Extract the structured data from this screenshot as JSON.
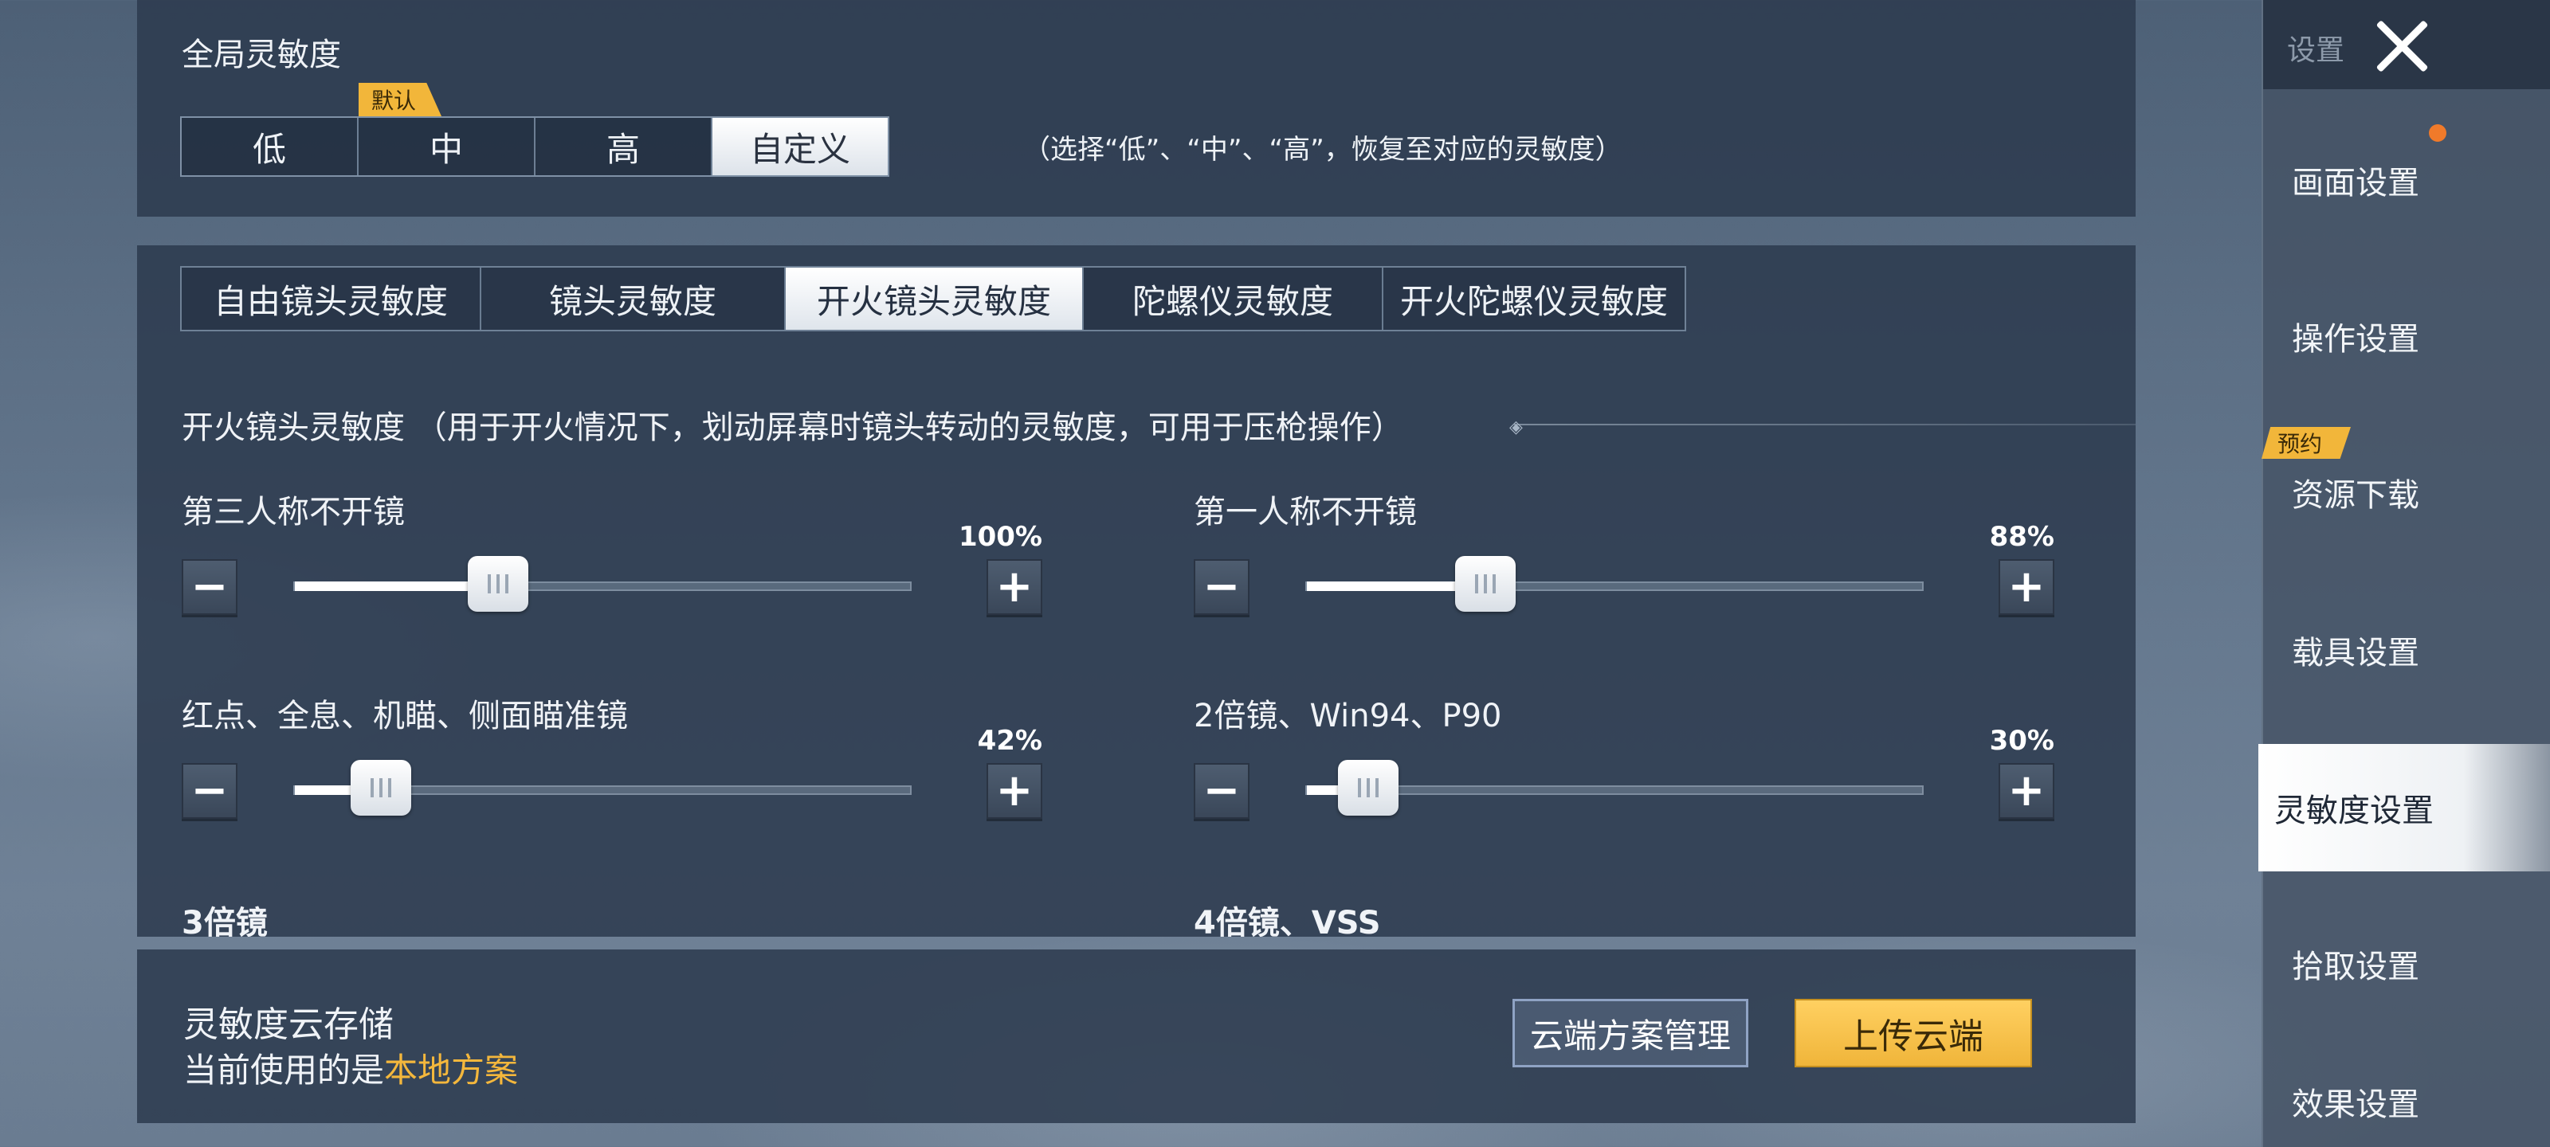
{
  "global": {
    "title": "全局灵敏度",
    "presets": [
      "低",
      "中",
      "高",
      "自定义"
    ],
    "active_preset_index": 3,
    "default_badge": "默认",
    "hint": "（选择“低”、“中”、“高”，恢复至对应的灵敏度）"
  },
  "tabs": [
    {
      "label": "自由镜头灵敏度",
      "active": false
    },
    {
      "label": "镜头灵敏度",
      "active": false
    },
    {
      "label": "开火镜头灵敏度",
      "active": true
    },
    {
      "label": "陀螺仪灵敏度",
      "active": false
    },
    {
      "label": "开火陀螺仪灵敏度",
      "active": false
    }
  ],
  "section": {
    "title": "开火镜头灵敏度 （用于开火情况下，划动屏幕时镜头转动的灵敏度，可用于压枪操作）"
  },
  "sliders": [
    {
      "label": "第三人称不开镜",
      "percent_text": "100%",
      "level": 0.33
    },
    {
      "label": "第一人称不开镜",
      "percent_text": "88%",
      "level": 0.29
    },
    {
      "label": "红点、全息、机瞄、侧面瞄准镜",
      "percent_text": "42%",
      "level": 0.14
    },
    {
      "label": "2倍镜、Win94、P90",
      "percent_text": "30%",
      "level": 0.1
    }
  ],
  "cut_labels": [
    "3倍镜",
    "4倍镜、VSS"
  ],
  "cloud": {
    "title": "灵敏度云存储",
    "status_prefix": "当前使用的是",
    "status_value": "本地方案",
    "manage_label": "云端方案管理",
    "upload_label": "上传云端"
  },
  "sidebar": {
    "header_label": "设置",
    "badge": "预约",
    "items": [
      {
        "label": "画面设置",
        "active": false
      },
      {
        "label": "操作设置",
        "active": false
      },
      {
        "label": "资源下载",
        "active": false
      },
      {
        "label": "载具设置",
        "active": false
      },
      {
        "label": "灵敏度设置",
        "active": true
      },
      {
        "label": "拾取设置",
        "active": false
      },
      {
        "label": "效果设置",
        "active": false
      }
    ]
  },
  "colors": {
    "accent_gold": "#f2b63a",
    "notification_dot": "#f07a2a",
    "panel": "#2c3a4e"
  }
}
